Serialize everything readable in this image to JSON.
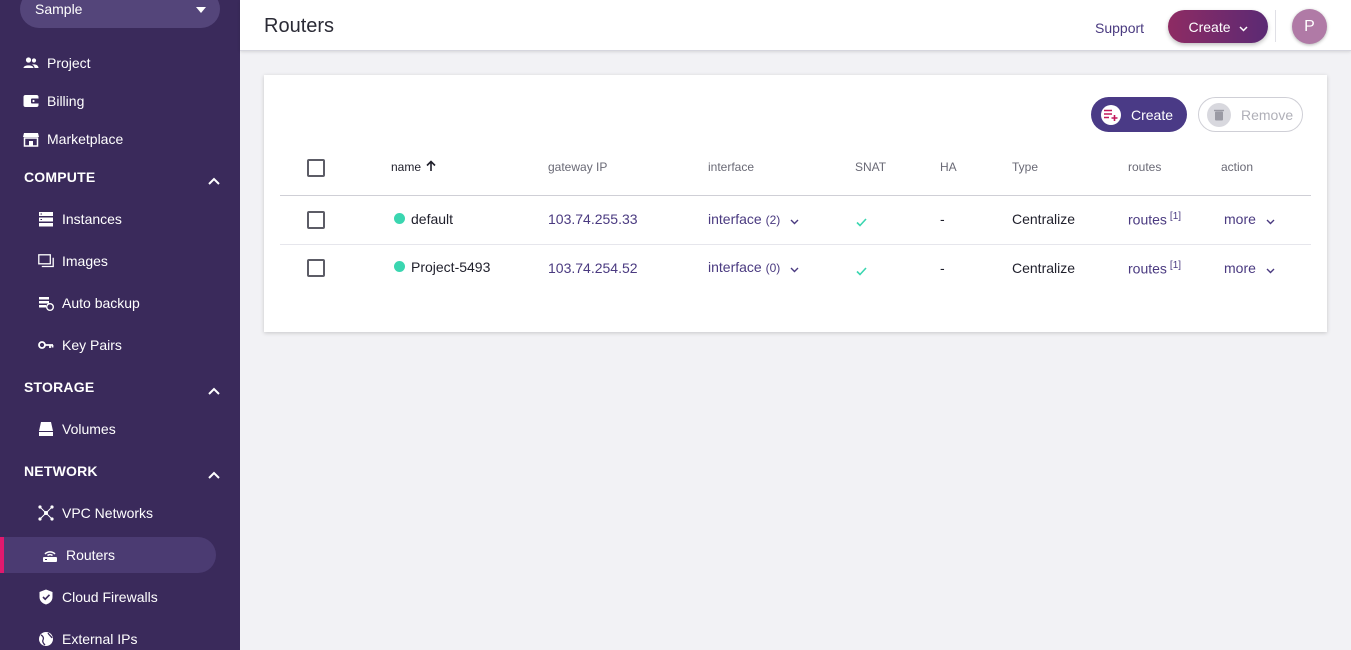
{
  "colors": {
    "sidebar_bg": "#3a2a5b",
    "active_accent": "#e0196e",
    "primary": "#4a3a86",
    "status_active": "#3ad6b0",
    "snat_check": "#3ad6b0"
  },
  "sidebar": {
    "project_select": "Sample",
    "top_items": [
      {
        "label": "Project",
        "icon": "users-icon"
      },
      {
        "label": "Billing",
        "icon": "wallet-icon"
      },
      {
        "label": "Marketplace",
        "icon": "store-icon"
      }
    ],
    "sections": {
      "compute": {
        "title": "COMPUTE",
        "items": [
          {
            "label": "Instances",
            "icon": "server-icon"
          },
          {
            "label": "Images",
            "icon": "images-icon"
          },
          {
            "label": "Auto backup",
            "icon": "backup-icon"
          },
          {
            "label": "Key Pairs",
            "icon": "key-icon"
          }
        ]
      },
      "storage": {
        "title": "STORAGE",
        "items": [
          {
            "label": "Volumes",
            "icon": "drive-icon"
          }
        ]
      },
      "network": {
        "title": "NETWORK",
        "items": [
          {
            "label": "VPC Networks",
            "icon": "network-icon"
          },
          {
            "label": "Routers",
            "icon": "router-icon",
            "active": true
          },
          {
            "label": "Cloud Firewalls",
            "icon": "shield-icon"
          },
          {
            "label": "External IPs",
            "icon": "globe-icon"
          }
        ]
      }
    }
  },
  "header": {
    "title": "Routers",
    "support": "Support",
    "create": "Create",
    "avatar": "P"
  },
  "toolbar": {
    "create": "Create",
    "remove": "Remove"
  },
  "table": {
    "columns": {
      "name": "name",
      "gateway_ip": "gateway IP",
      "interface": "interface",
      "snat": "SNAT",
      "ha": "HA",
      "type": "Type",
      "routes": "routes",
      "action": "action"
    },
    "rows": [
      {
        "name": "default",
        "status": "active",
        "gateway_ip": "103.74.255.33",
        "interface_label": "interface",
        "interface_count": "(2)",
        "snat": true,
        "ha": "-",
        "type": "Centralize",
        "routes_label": "routes",
        "routes_count": "[1]",
        "action": "more"
      },
      {
        "name": "Project-5493",
        "status": "active",
        "gateway_ip": "103.74.254.52",
        "interface_label": "interface",
        "interface_count": "(0)",
        "snat": true,
        "ha": "-",
        "type": "Centralize",
        "routes_label": "routes",
        "routes_count": "[1]",
        "action": "more"
      }
    ]
  }
}
